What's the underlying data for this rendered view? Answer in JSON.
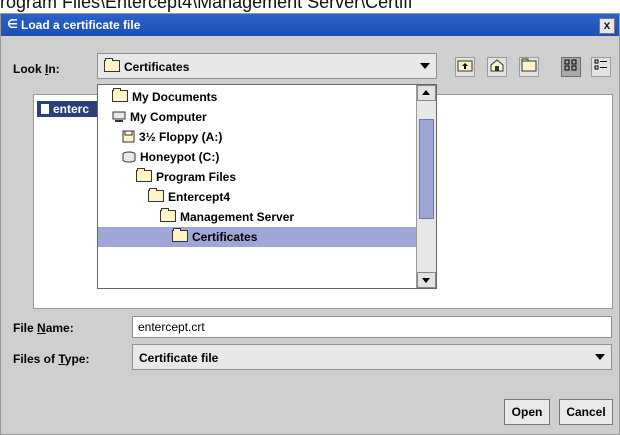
{
  "background": {
    "text": "rogram Files\\Entercept4\\Management Server\\Certifi"
  },
  "window": {
    "title": "Load a certificate file",
    "close_label": "x"
  },
  "look_in": {
    "label_prefix": "Look ",
    "label_mnemonic": "I",
    "label_suffix": "n:",
    "value": "Certificates"
  },
  "toolbar": [
    {
      "name": "up-folder-button",
      "icon": "up-folder-icon"
    },
    {
      "name": "home-button",
      "icon": "home-icon"
    },
    {
      "name": "new-folder-button",
      "icon": "new-folder-icon"
    },
    {
      "name": "list-view-button",
      "icon": "list-view-icon",
      "pressed": true
    },
    {
      "name": "details-view-button",
      "icon": "details-view-icon"
    }
  ],
  "file_list": {
    "items": [
      {
        "label": "enterc",
        "icon": "file-icon"
      }
    ]
  },
  "dropdown": {
    "items": [
      {
        "label": "My Documents",
        "icon": "folder-icon",
        "indent": 0
      },
      {
        "label": "My Computer",
        "icon": "computer-icon",
        "indent": 0
      },
      {
        "label": "3½ Floppy (A:)",
        "icon": "floppy-icon",
        "indent": 1
      },
      {
        "label": "Honeypot (C:)",
        "icon": "hard-drive-icon",
        "indent": 1
      },
      {
        "label": "Program Files",
        "icon": "folder-icon",
        "indent": 2
      },
      {
        "label": "Entercept4",
        "icon": "folder-icon",
        "indent": 3
      },
      {
        "label": "Management Server",
        "icon": "folder-icon",
        "indent": 4
      },
      {
        "label": "Certificates",
        "icon": "folder-icon",
        "indent": 5,
        "selected": true
      }
    ]
  },
  "file_name": {
    "label_prefix": "File ",
    "label_mnemonic": "N",
    "label_suffix": "ame:",
    "value": "entercept.crt"
  },
  "file_type": {
    "label_prefix": "Files of ",
    "label_mnemonic": "T",
    "label_suffix": "ype:",
    "value": "Certificate file"
  },
  "buttons": {
    "open": "Open",
    "cancel": "Cancel"
  },
  "colors": {
    "title_bar": "#1d4fb6",
    "selection": "#9fa7d6",
    "file_selected": "#2b3f7a"
  }
}
